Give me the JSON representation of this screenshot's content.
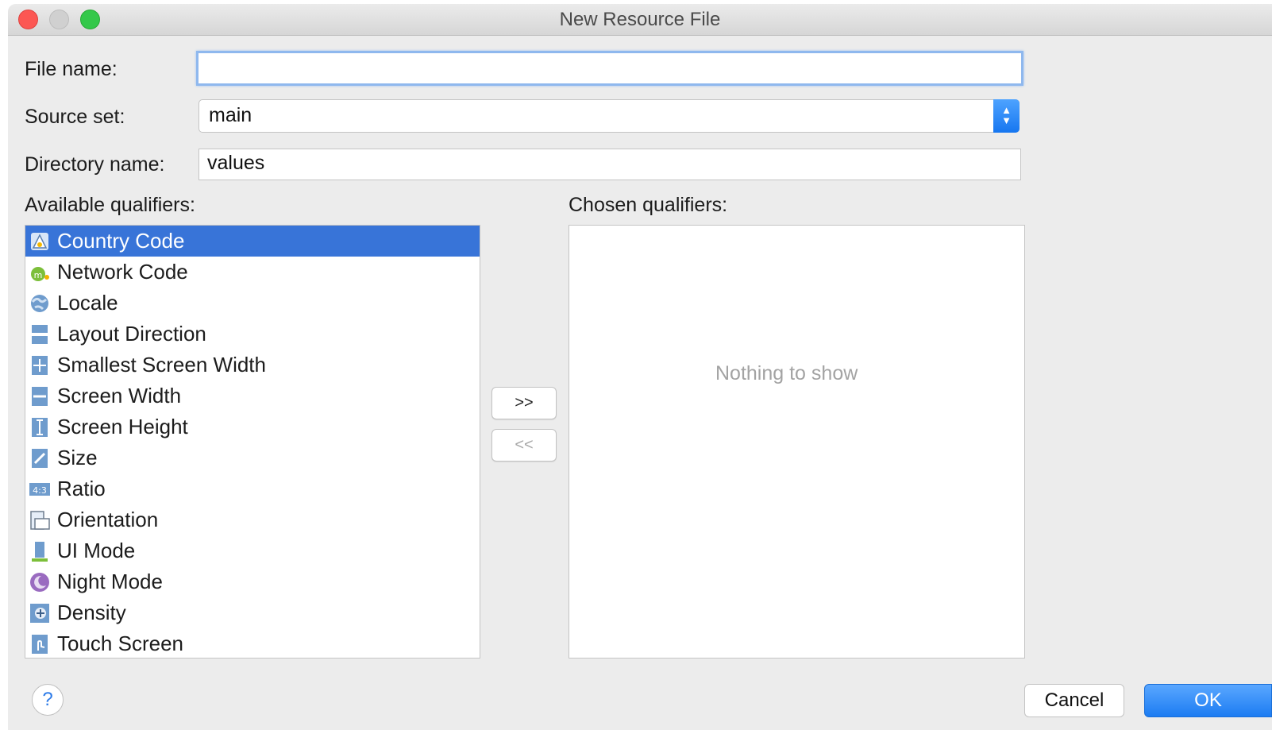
{
  "window": {
    "title": "New Resource File"
  },
  "form": {
    "file_name_label": "File name:",
    "file_name_value": "",
    "source_set_label": "Source set:",
    "source_set_value": "main",
    "directory_name_label": "Directory name:",
    "directory_name_value": "values"
  },
  "available": {
    "label": "Available qualifiers:",
    "items": [
      {
        "label": "Country Code",
        "icon": "country-code-icon",
        "selected": true
      },
      {
        "label": "Network Code",
        "icon": "network-code-icon",
        "selected": false
      },
      {
        "label": "Locale",
        "icon": "globe-icon",
        "selected": false
      },
      {
        "label": "Layout Direction",
        "icon": "layout-direction-icon",
        "selected": false
      },
      {
        "label": "Smallest Screen Width",
        "icon": "smallest-width-icon",
        "selected": false
      },
      {
        "label": "Screen Width",
        "icon": "screen-width-icon",
        "selected": false
      },
      {
        "label": "Screen Height",
        "icon": "screen-height-icon",
        "selected": false
      },
      {
        "label": "Size",
        "icon": "size-icon",
        "selected": false
      },
      {
        "label": "Ratio",
        "icon": "ratio-icon",
        "selected": false
      },
      {
        "label": "Orientation",
        "icon": "orientation-icon",
        "selected": false
      },
      {
        "label": "UI Mode",
        "icon": "ui-mode-icon",
        "selected": false
      },
      {
        "label": "Night Mode",
        "icon": "night-mode-icon",
        "selected": false
      },
      {
        "label": "Density",
        "icon": "density-icon",
        "selected": false
      },
      {
        "label": "Touch Screen",
        "icon": "touch-screen-icon",
        "selected": false
      }
    ]
  },
  "chosen": {
    "label": "Chosen qualifiers:",
    "empty_text": "Nothing to show"
  },
  "buttons": {
    "add": ">>",
    "remove": "<<",
    "help": "?",
    "cancel": "Cancel",
    "ok": "OK"
  },
  "colors": {
    "selection": "#3874d8",
    "accent": "#1c7cf2",
    "close": "#fc5753",
    "maximize": "#34c84a"
  }
}
